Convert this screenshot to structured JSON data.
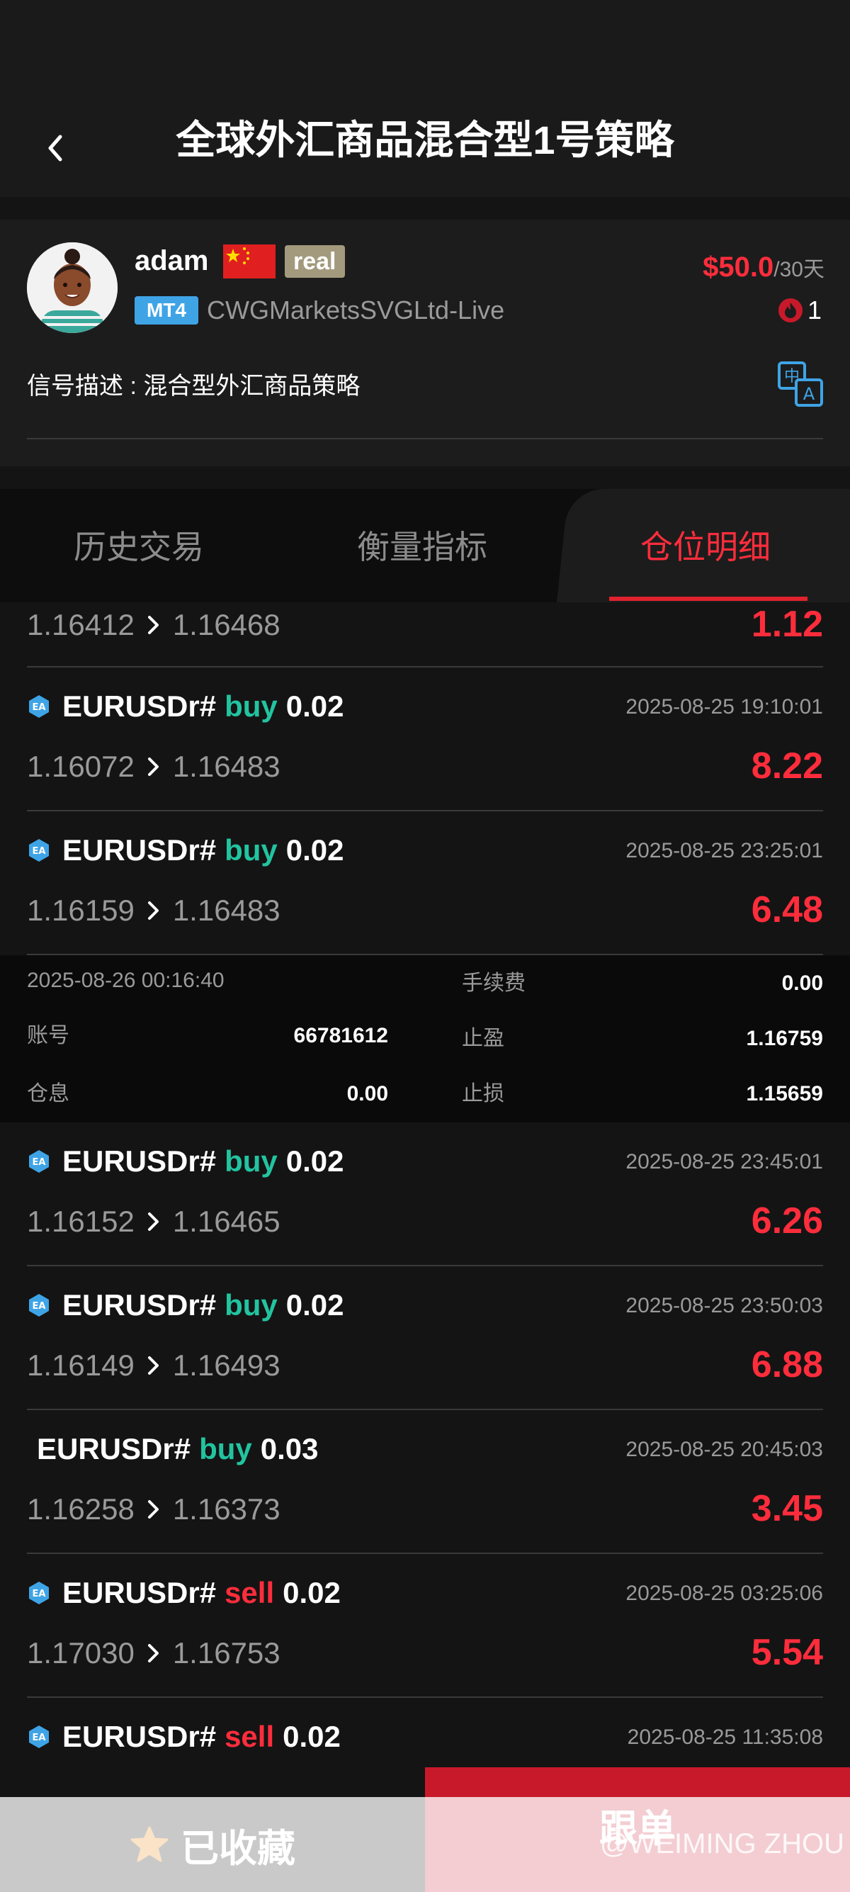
{
  "header": {
    "title": "全球外汇商品混合型1号策略"
  },
  "profile": {
    "name": "adam",
    "account_type": "real",
    "platform": "MT4",
    "broker": "CWGMarketsSVGLtd-Live",
    "price": "$50.0",
    "price_period": "/30天",
    "followers": "1",
    "description": "信号描述 : 混合型外汇商品策略"
  },
  "tabs": [
    {
      "label": "历史交易",
      "active": false
    },
    {
      "label": "衡量指标",
      "active": false
    },
    {
      "label": "仓位明细",
      "active": true
    }
  ],
  "partial_trade": {
    "open": "1.16412",
    "close": "1.16468",
    "profit": "1.12"
  },
  "trades_before": [
    {
      "symbol": "EURUSDr#",
      "direction": "buy",
      "lots": "0.02",
      "time": "2025-08-25 19:10:01",
      "open": "1.16072",
      "close": "1.16483",
      "profit": "8.22",
      "ea": true
    },
    {
      "symbol": "EURUSDr#",
      "direction": "buy",
      "lots": "0.02",
      "time": "2025-08-25 23:25:01",
      "open": "1.16159",
      "close": "1.16483",
      "profit": "6.48",
      "ea": true
    }
  ],
  "detail": {
    "time": "2025-08-26 00:16:40",
    "fee_label": "手续费",
    "fee": "0.00",
    "account_label": "账号",
    "account": "66781612",
    "tp_label": "止盈",
    "tp": "1.16759",
    "swap_label": "仓息",
    "swap": "0.00",
    "sl_label": "止损",
    "sl": "1.15659"
  },
  "trades_after": [
    {
      "symbol": "EURUSDr#",
      "direction": "buy",
      "lots": "0.02",
      "time": "2025-08-25 23:45:01",
      "open": "1.16152",
      "close": "1.16465",
      "profit": "6.26",
      "ea": true
    },
    {
      "symbol": "EURUSDr#",
      "direction": "buy",
      "lots": "0.02",
      "time": "2025-08-25 23:50:03",
      "open": "1.16149",
      "close": "1.16493",
      "profit": "6.88",
      "ea": true
    },
    {
      "symbol": "EURUSDr#",
      "direction": "buy",
      "lots": "0.03",
      "time": "2025-08-25 20:45:03",
      "open": "1.16258",
      "close": "1.16373",
      "profit": "3.45",
      "ea": false
    },
    {
      "symbol": "EURUSDr#",
      "direction": "sell",
      "lots": "0.02",
      "time": "2025-08-25 03:25:06",
      "open": "1.17030",
      "close": "1.16753",
      "profit": "5.54",
      "ea": true
    },
    {
      "symbol": "EURUSDr#",
      "direction": "sell",
      "lots": "0.02",
      "time": "2025-08-25 11:35:08",
      "open": "",
      "close": "",
      "profit": "",
      "ea": true
    }
  ],
  "bottom": {
    "favorite_label": "已收藏",
    "follow_label": "跟单",
    "watermark": "@WEIMING ZHOU"
  },
  "colors": {
    "accent_red": "#ff2d3c",
    "buy_green": "#22c4a0",
    "mt4_blue": "#3fa4e6"
  }
}
